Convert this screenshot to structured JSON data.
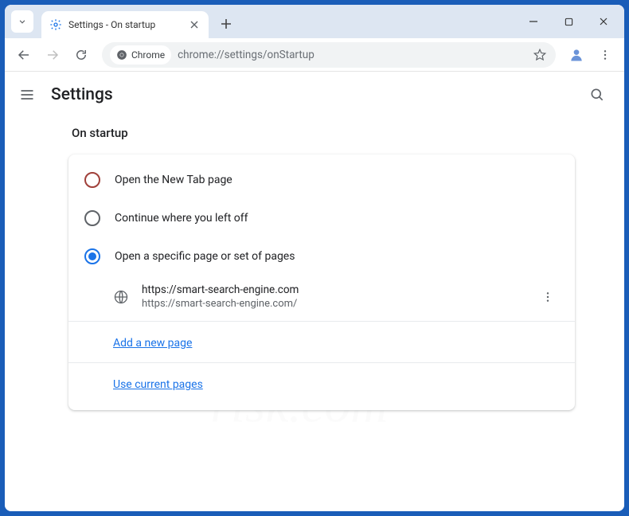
{
  "tab": {
    "title": "Settings - On startup"
  },
  "omnibox": {
    "chip_label": "Chrome",
    "url": "chrome://settings/onStartup"
  },
  "settings": {
    "header_title": "Settings",
    "section_title": "On startup",
    "options": {
      "opt1": "Open the New Tab page",
      "opt2": "Continue where you left off",
      "opt3": "Open a specific page or set of pages"
    },
    "page_entry": {
      "title": "https://smart-search-engine.com",
      "url": "https://smart-search-engine.com/"
    },
    "links": {
      "add_page": "Add a new page",
      "use_current": "Use current pages"
    }
  }
}
